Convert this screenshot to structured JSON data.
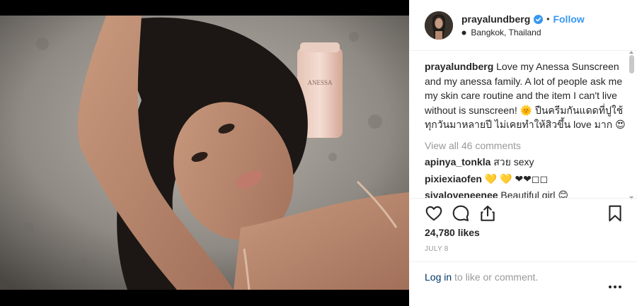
{
  "post": {
    "username": "prayalundberg",
    "follow_label": "Follow",
    "separator": "•",
    "location": "Bangkok, Thailand",
    "product_brand": "ANESSA",
    "caption": {
      "username": "prayalundberg",
      "text": "Love my Anessa Sunscreen and my anessa family. A lot of people ask me my skin care routine and the item I can't live without is sunscreen! 🌞 ปืนครีมกันแดดที่ปูใช้ทุกวันมาหลายปี ไม่เคยทำให้สิวขึ้น love มาก 😍"
    },
    "view_all_label": "View all 46 comments",
    "comments": [
      {
        "username": "apinya_tonkla",
        "text": "สวย sexy"
      },
      {
        "username": "pixiexiaofen",
        "text": "💛 💛 ❤❤◻◻"
      },
      {
        "username": "siyaloveneenee",
        "text": "Beautiful girl 😊"
      }
    ],
    "likes": "24,780 likes",
    "date": "JULY 8",
    "login_link": "Log in",
    "login_rest": " to like or comment."
  },
  "icons": [
    "verified-icon",
    "location-pin-icon",
    "heart-icon",
    "comment-icon",
    "share-icon",
    "bookmark-icon",
    "more-options-icon"
  ],
  "colors": {
    "accent": "#3897f0",
    "link": "#003569",
    "muted": "#999999",
    "text": "#262626"
  }
}
